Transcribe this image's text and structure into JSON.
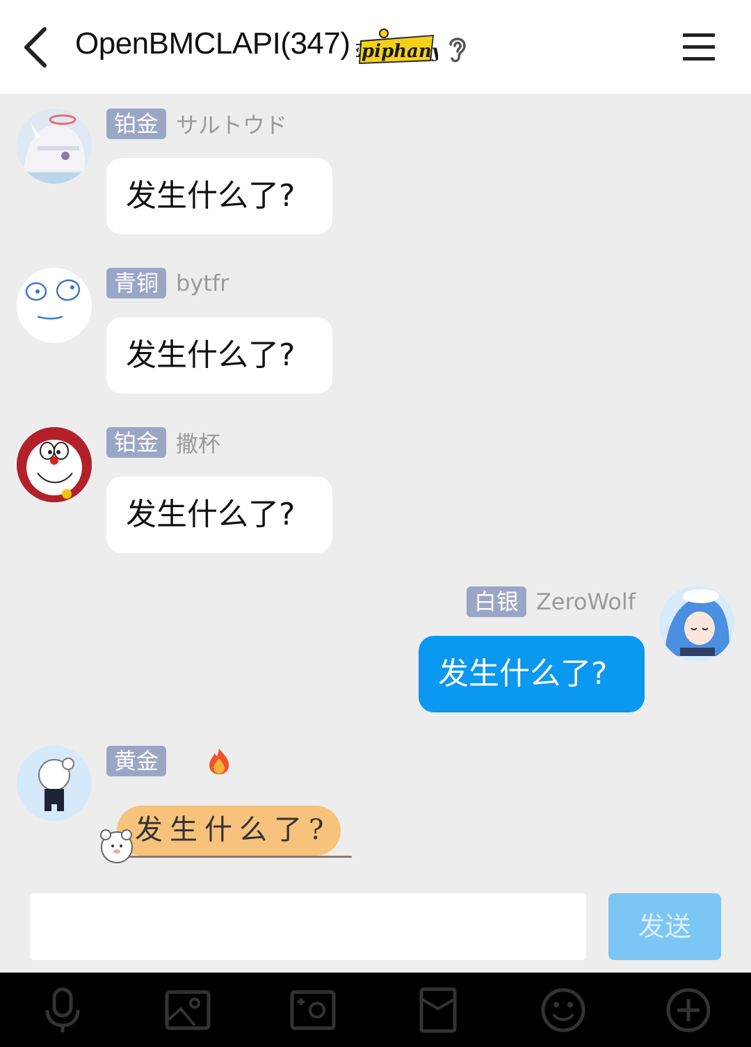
{
  "header": {
    "title": "OpenBMCLAPI(347)",
    "logo_text": "Epiphany"
  },
  "messages": [
    {
      "tag": "铂金",
      "name": "サルトウド",
      "text": "发生什么了?"
    },
    {
      "tag": "青铜",
      "name": "bytfr",
      "text": "发生什么了?"
    },
    {
      "tag": "铂金",
      "name": "撒杯",
      "text": "发生什么了?"
    },
    {
      "tag": "白银",
      "name": "ZeroWolf",
      "text": "发生什么了?"
    },
    {
      "tag": "黄金",
      "name": "",
      "text": "发生什么了?"
    }
  ],
  "composer": {
    "send_label": "发送",
    "input_value": ""
  },
  "colors": {
    "bubble_mine": "#0b98f0",
    "tag_bg": "#9aa6c6",
    "send_disabled": "#7cc6f5"
  },
  "toolbar": [
    "microphone-icon",
    "image-icon",
    "camera-icon",
    "red-packet-icon",
    "emoji-icon",
    "plus-icon"
  ]
}
